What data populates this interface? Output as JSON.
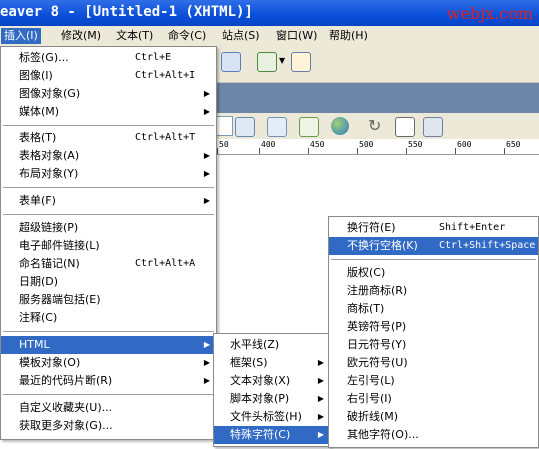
{
  "window": {
    "title": "eaver 8 - [Untitled-1 (XHTML)]",
    "watermark": "webjx.com"
  },
  "menubar": {
    "items": [
      "插入(I)",
      "修改(M)",
      "文本(T)",
      "命令(C)",
      "站点(S)",
      "窗口(W)",
      "帮助(H)"
    ]
  },
  "ruler": {
    "labels": [
      "50",
      "400",
      "450",
      "500",
      "550",
      "600",
      "650"
    ]
  },
  "insert_menu": [
    {
      "label": "标签(G)...",
      "shortcut": "Ctrl+E",
      "submenu": false
    },
    {
      "label": "图像(I)",
      "shortcut": "Ctrl+Alt+I",
      "submenu": false
    },
    {
      "label": "图像对象(G)",
      "shortcut": "",
      "submenu": true
    },
    {
      "label": "媒体(M)",
      "shortcut": "",
      "submenu": true
    },
    {
      "label": "表格(T)",
      "shortcut": "Ctrl+Alt+T",
      "submenu": false
    },
    {
      "label": "表格对象(A)",
      "shortcut": "",
      "submenu": true
    },
    {
      "label": "布局对象(Y)",
      "shortcut": "",
      "submenu": true
    },
    {
      "label": "表单(F)",
      "shortcut": "",
      "submenu": true
    },
    {
      "label": "超级链接(P)",
      "shortcut": "",
      "submenu": false
    },
    {
      "label": "电子邮件链接(L)",
      "shortcut": "",
      "submenu": false
    },
    {
      "label": "命名锚记(N)",
      "shortcut": "Ctrl+Alt+A",
      "submenu": false
    },
    {
      "label": "日期(D)",
      "shortcut": "",
      "submenu": false
    },
    {
      "label": "服务器端包括(E)",
      "shortcut": "",
      "submenu": false
    },
    {
      "label": "注释(C)",
      "shortcut": "",
      "submenu": false
    },
    {
      "label": "HTML",
      "shortcut": "",
      "submenu": true
    },
    {
      "label": "模板对象(O)",
      "shortcut": "",
      "submenu": true
    },
    {
      "label": "最近的代码片断(R)",
      "shortcut": "",
      "submenu": true
    },
    {
      "label": "自定义收藏夹(U)...",
      "shortcut": "",
      "submenu": false
    },
    {
      "label": "获取更多对象(G)...",
      "shortcut": "",
      "submenu": false
    }
  ],
  "html_menu": [
    {
      "label": "水平线(Z)",
      "submenu": false
    },
    {
      "label": "框架(S)",
      "submenu": true
    },
    {
      "label": "文本对象(X)",
      "submenu": true
    },
    {
      "label": "脚本对象(P)",
      "submenu": true
    },
    {
      "label": "文件头标签(H)",
      "submenu": true
    },
    {
      "label": "特殊字符(C)",
      "submenu": true
    }
  ],
  "special_chars_menu": [
    {
      "label": "换行符(E)",
      "shortcut": "Shift+Enter"
    },
    {
      "label": "不换行空格(K)",
      "shortcut": "Ctrl+Shift+Space"
    },
    {
      "label": "版权(C)",
      "shortcut": ""
    },
    {
      "label": "注册商标(R)",
      "shortcut": ""
    },
    {
      "label": "商标(T)",
      "shortcut": ""
    },
    {
      "label": "英镑符号(P)",
      "shortcut": ""
    },
    {
      "label": "日元符号(Y)",
      "shortcut": ""
    },
    {
      "label": "欧元符号(U)",
      "shortcut": ""
    },
    {
      "label": "左引号(L)",
      "shortcut": ""
    },
    {
      "label": "右引号(I)",
      "shortcut": ""
    },
    {
      "label": "破折线(M)",
      "shortcut": ""
    },
    {
      "label": "其他字符(O)...",
      "shortcut": ""
    }
  ],
  "icons": [
    "layout-icon",
    "file-icon",
    "browser-check-icon",
    "debug-icon",
    "validate-icon",
    "globe-icon",
    "refresh-icon",
    "view-options-icon",
    "visual-aids-icon"
  ],
  "colors": {
    "highlight": "#316ac5",
    "titlebar": "#0a4fd8",
    "menubar": "#ece9d8",
    "watermark": "#e02020"
  }
}
